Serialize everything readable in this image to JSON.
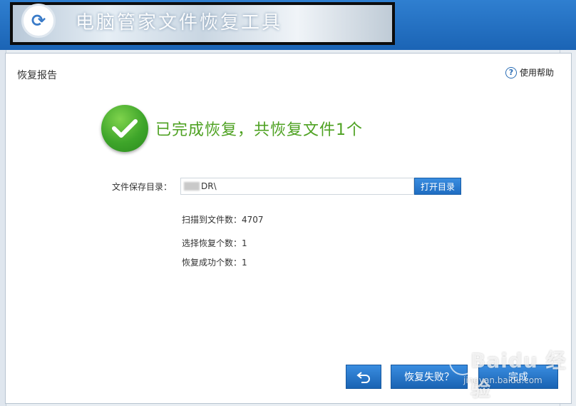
{
  "app": {
    "title": "电脑管家文件恢复工具",
    "logo_icon": "qq-pcmgr-logo-icon"
  },
  "dialog": {
    "title": "恢复报告",
    "help_label": "使用帮助",
    "help_icon": "question-circle-icon",
    "success_icon": "check-circle-icon",
    "success_message": "已完成恢复，共恢复文件1个",
    "dir_label": "文件保存目录：",
    "dir_value_visible": "DR\\",
    "open_dir_button": "打开目录",
    "scanned": "扫描到文件数：4707",
    "selected": "选择恢复个数：1",
    "succeeded": "恢复成功个数：1",
    "back_icon": "back-arrow-icon",
    "fail_button": "恢复失败？",
    "done_button": "完成"
  },
  "watermark": {
    "main": "Baidu 经验",
    "sub": "jingyan.baidu.com"
  },
  "colors": {
    "accent_blue": "#1f6dc2",
    "success_green": "#4fa223"
  }
}
